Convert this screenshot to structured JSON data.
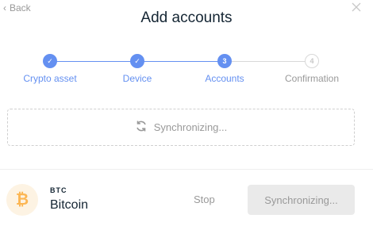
{
  "header": {
    "back_label": "Back",
    "title": "Add accounts"
  },
  "stepper": {
    "steps": [
      {
        "label": "Crypto asset",
        "status": "done",
        "marker": "✓"
      },
      {
        "label": "Device",
        "status": "done",
        "marker": "✓"
      },
      {
        "label": "Accounts",
        "status": "active",
        "marker": "3"
      },
      {
        "label": "Confirmation",
        "status": "todo",
        "marker": "4"
      }
    ]
  },
  "sync_status": {
    "text": "Synchronizing...",
    "icon": "sync-icon"
  },
  "footer": {
    "coin_icon": "bitcoin-icon",
    "coin_symbol": "₿",
    "ticker": "BTC",
    "coin_name": "Bitcoin",
    "stop_label": "Stop",
    "sync_button_label": "Synchronizing..."
  },
  "colors": {
    "accent": "#6490f1",
    "bitcoin": "#fcb653",
    "muted": "#999999"
  }
}
